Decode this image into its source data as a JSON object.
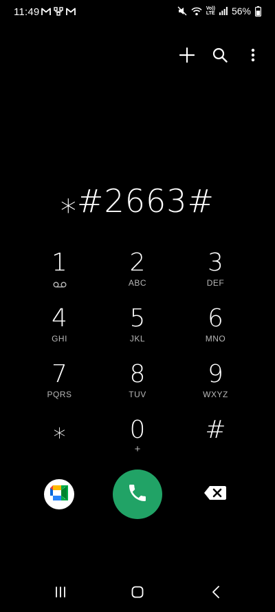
{
  "status_bar": {
    "time": "11:49",
    "battery": "56%",
    "volte_label_top": "Vo))",
    "volte_label_bottom": "LTE",
    "icons": [
      "gmail-icon",
      "network-icon",
      "gmail-icon",
      "mute-icon",
      "wifi-icon",
      "volte-icon",
      "signal-icon",
      "battery-icon"
    ]
  },
  "toolbar": {
    "icons": [
      "plus-icon",
      "search-icon",
      "more-icon"
    ]
  },
  "dialer": {
    "number": "⁎#2663#"
  },
  "keypad": {
    "keys": [
      {
        "digit": "1",
        "letters": ""
      },
      {
        "digit": "2",
        "letters": "ABC"
      },
      {
        "digit": "3",
        "letters": "DEF"
      },
      {
        "digit": "4",
        "letters": "GHI"
      },
      {
        "digit": "5",
        "letters": "JKL"
      },
      {
        "digit": "6",
        "letters": "MNO"
      },
      {
        "digit": "7",
        "letters": "PQRS"
      },
      {
        "digit": "8",
        "letters": "TUV"
      },
      {
        "digit": "9",
        "letters": "WXYZ"
      },
      {
        "digit": "⁎",
        "letters": ""
      },
      {
        "digit": "0",
        "letters": "+"
      },
      {
        "digit": "#",
        "letters": ""
      }
    ]
  },
  "actions": {
    "icons": [
      "google-meet-icon",
      "phone-icon",
      "backspace-icon"
    ],
    "call_color": "#21a366"
  },
  "nav_bar": {
    "icons": [
      "recents-icon",
      "home-icon",
      "back-icon"
    ]
  }
}
